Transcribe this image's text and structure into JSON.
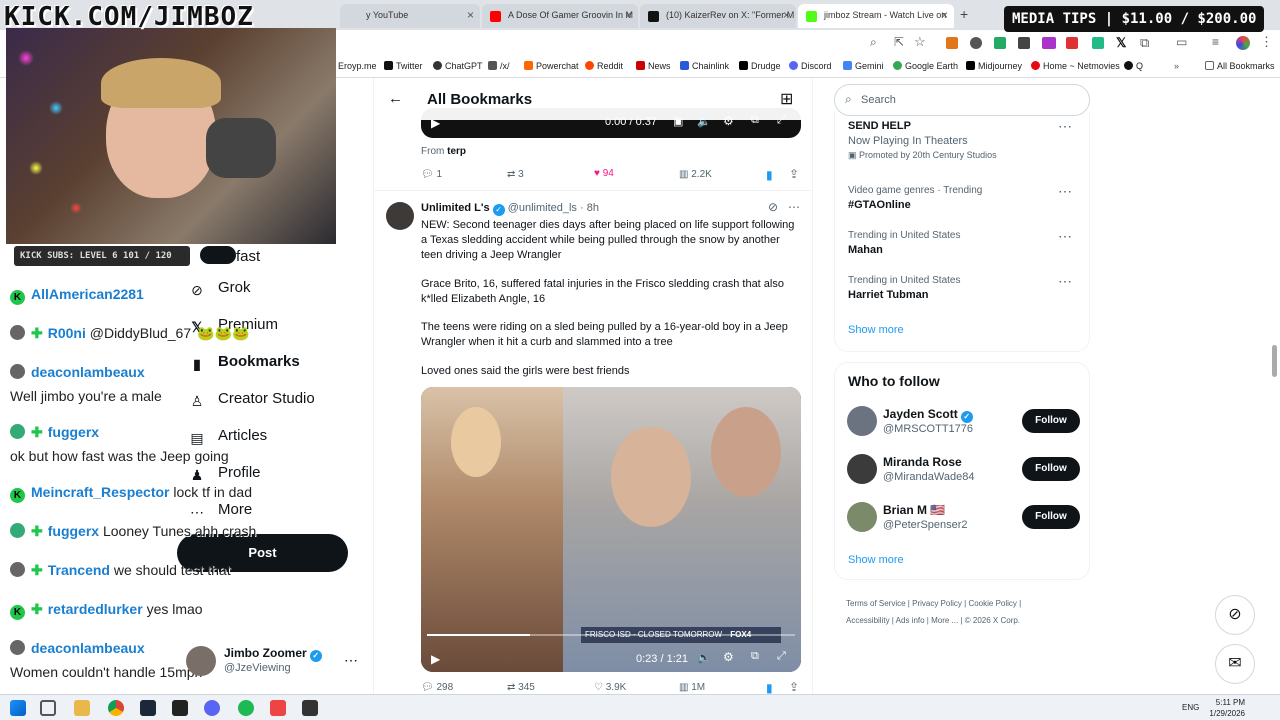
{
  "watermark": "KICK.COM/JIMBOZ",
  "media_tips": "MEDIA TIPS | $11.00 / $200.00",
  "kick_subs": "KICK SUBS: LEVEL 6 101 / 120",
  "tabs": [
    {
      "label": "y YouTube",
      "color": "#ff0000"
    },
    {
      "label": "A Dose Of Gamer Groovin In M",
      "color": "#ff0000"
    },
    {
      "label": "(10) KaizerRev on X: \"Former M",
      "color": "#111111"
    },
    {
      "label": "jimboz Stream - Watch Live on",
      "color": "#53fc18"
    }
  ],
  "bookmarks": [
    {
      "label": "Eroyp.me",
      "color": "#888"
    },
    {
      "label": "Twitter",
      "color": "#111"
    },
    {
      "label": "ChatGPT",
      "color": "#333"
    },
    {
      "label": "/x/",
      "color": "#555"
    },
    {
      "label": "Powerchat",
      "color": "#ff6600"
    },
    {
      "label": "Reddit",
      "color": "#ff4500"
    },
    {
      "label": "News",
      "color": "#cc0000"
    },
    {
      "label": "Chainlink",
      "color": "#2a5ada"
    },
    {
      "label": "Drudge",
      "color": "#000"
    },
    {
      "label": "Discord",
      "color": "#5865f2"
    },
    {
      "label": "Gemini",
      "color": "#4285f4"
    },
    {
      "label": "Google Earth",
      "color": "#34a853"
    },
    {
      "label": "Midjourney",
      "color": "#000"
    },
    {
      "label": "Home ~ Netmovies",
      "color": "#e50914"
    },
    {
      "label": "Q",
      "color": "#111"
    },
    {
      "label": "All Bookmarks",
      "color": "#666"
    }
  ],
  "nav": {
    "fast": "fast",
    "grok": "Grok",
    "premium": "Premium",
    "bookmarks": "Bookmarks",
    "creator_studio": "Creator Studio",
    "articles": "Articles",
    "profile": "Profile",
    "more": "More",
    "post": "Post"
  },
  "chat": [
    {
      "user": "AllAmerican2281",
      "msg": ""
    },
    {
      "user": "R00ni",
      "msg": "@DiddyBlud_67"
    },
    {
      "user": "deaconlambeaux",
      "msg": ""
    },
    {
      "user": "",
      "msg": "Well jimbo you're a male"
    },
    {
      "user": "fuggerx",
      "msg": ""
    },
    {
      "user": "",
      "msg": "ok but how fast was the Jeep going"
    },
    {
      "user": "Meincraft_Respector",
      "msg": "lock tf in dad"
    },
    {
      "user": "fuggerx",
      "msg": "Looney Tunes ahh crash"
    },
    {
      "user": "Trancend",
      "msg": "we should test that"
    },
    {
      "user": "retardedlurker",
      "msg": "yes lmao"
    },
    {
      "user": "deaconlambeaux",
      "msg": ""
    },
    {
      "user": "",
      "msg": "Women couldn't handle 15mph"
    }
  ],
  "account": {
    "name": "Jimbo Zoomer",
    "handle": "@JzeViewing"
  },
  "header": {
    "title": "All Bookmarks"
  },
  "tweet1": {
    "video_time": "0:00 / 0:37",
    "from_label": "From",
    "from_user": "terp",
    "replies": "1",
    "reposts": "3",
    "likes": "94",
    "views": "2.2K"
  },
  "tweet2": {
    "name": "Unlimited L's",
    "handle": "@unlimited_ls",
    "time": "· 8h",
    "p1": "NEW: Second teenager dies days after being placed on life support following a Texas sledding accident while being pulled through the snow by another teen driving a Jeep Wrangler",
    "p2": "Grace Brito, 16, suffered fatal injuries in the Frisco sledding crash that also k*lled Elizabeth Angle, 16",
    "p3": "The teens were riding on a sled being pulled by a 16-year-old boy in a Jeep Wrangler when it hit a curb and slammed into a tree",
    "p4": "Loved ones said the girls were best friends",
    "video_time": "0:23 / 1:21",
    "chyron": "FRISCO ISD - CLOSED TOMORROW",
    "channel": "FOX4",
    "replies": "298",
    "reposts": "345",
    "likes": "3.9K",
    "views": "1M"
  },
  "search": {
    "placeholder": "Search"
  },
  "trends": [
    {
      "ctx": "",
      "title": "SEND HELP",
      "sub": "Now Playing In Theaters",
      "promo": "Promoted by 20th Century Studios"
    },
    {
      "ctx": "Video game genres · Trending",
      "title": "#GTAOnline"
    },
    {
      "ctx": "Trending in United States",
      "title": "Mahan"
    },
    {
      "ctx": "Trending in United States",
      "title": "Harriet Tubman"
    }
  ],
  "show_more": "Show more",
  "who_to_follow": {
    "title": "Who to follow",
    "users": [
      {
        "name": "Jayden Scott",
        "handle": "@MRSCOTT1776",
        "button": "Follow"
      },
      {
        "name": "Miranda Rose",
        "handle": "@MirandaWade84",
        "button": "Follow"
      },
      {
        "name": "Brian M 🇺🇸",
        "handle": "@PeterSpenser2",
        "button": "Follow"
      }
    ],
    "show_more": "Show more"
  },
  "footer": {
    "terms": "Terms of Service",
    "privacy": "Privacy Policy",
    "cookie": "Cookie Policy",
    "accessibility": "Accessibility",
    "ads": "Ads info",
    "more": "More ...",
    "copyright": "© 2026 X Corp."
  },
  "clock": {
    "time": "5:11 PM",
    "date": "1/29/2026",
    "lang": "ENG"
  }
}
